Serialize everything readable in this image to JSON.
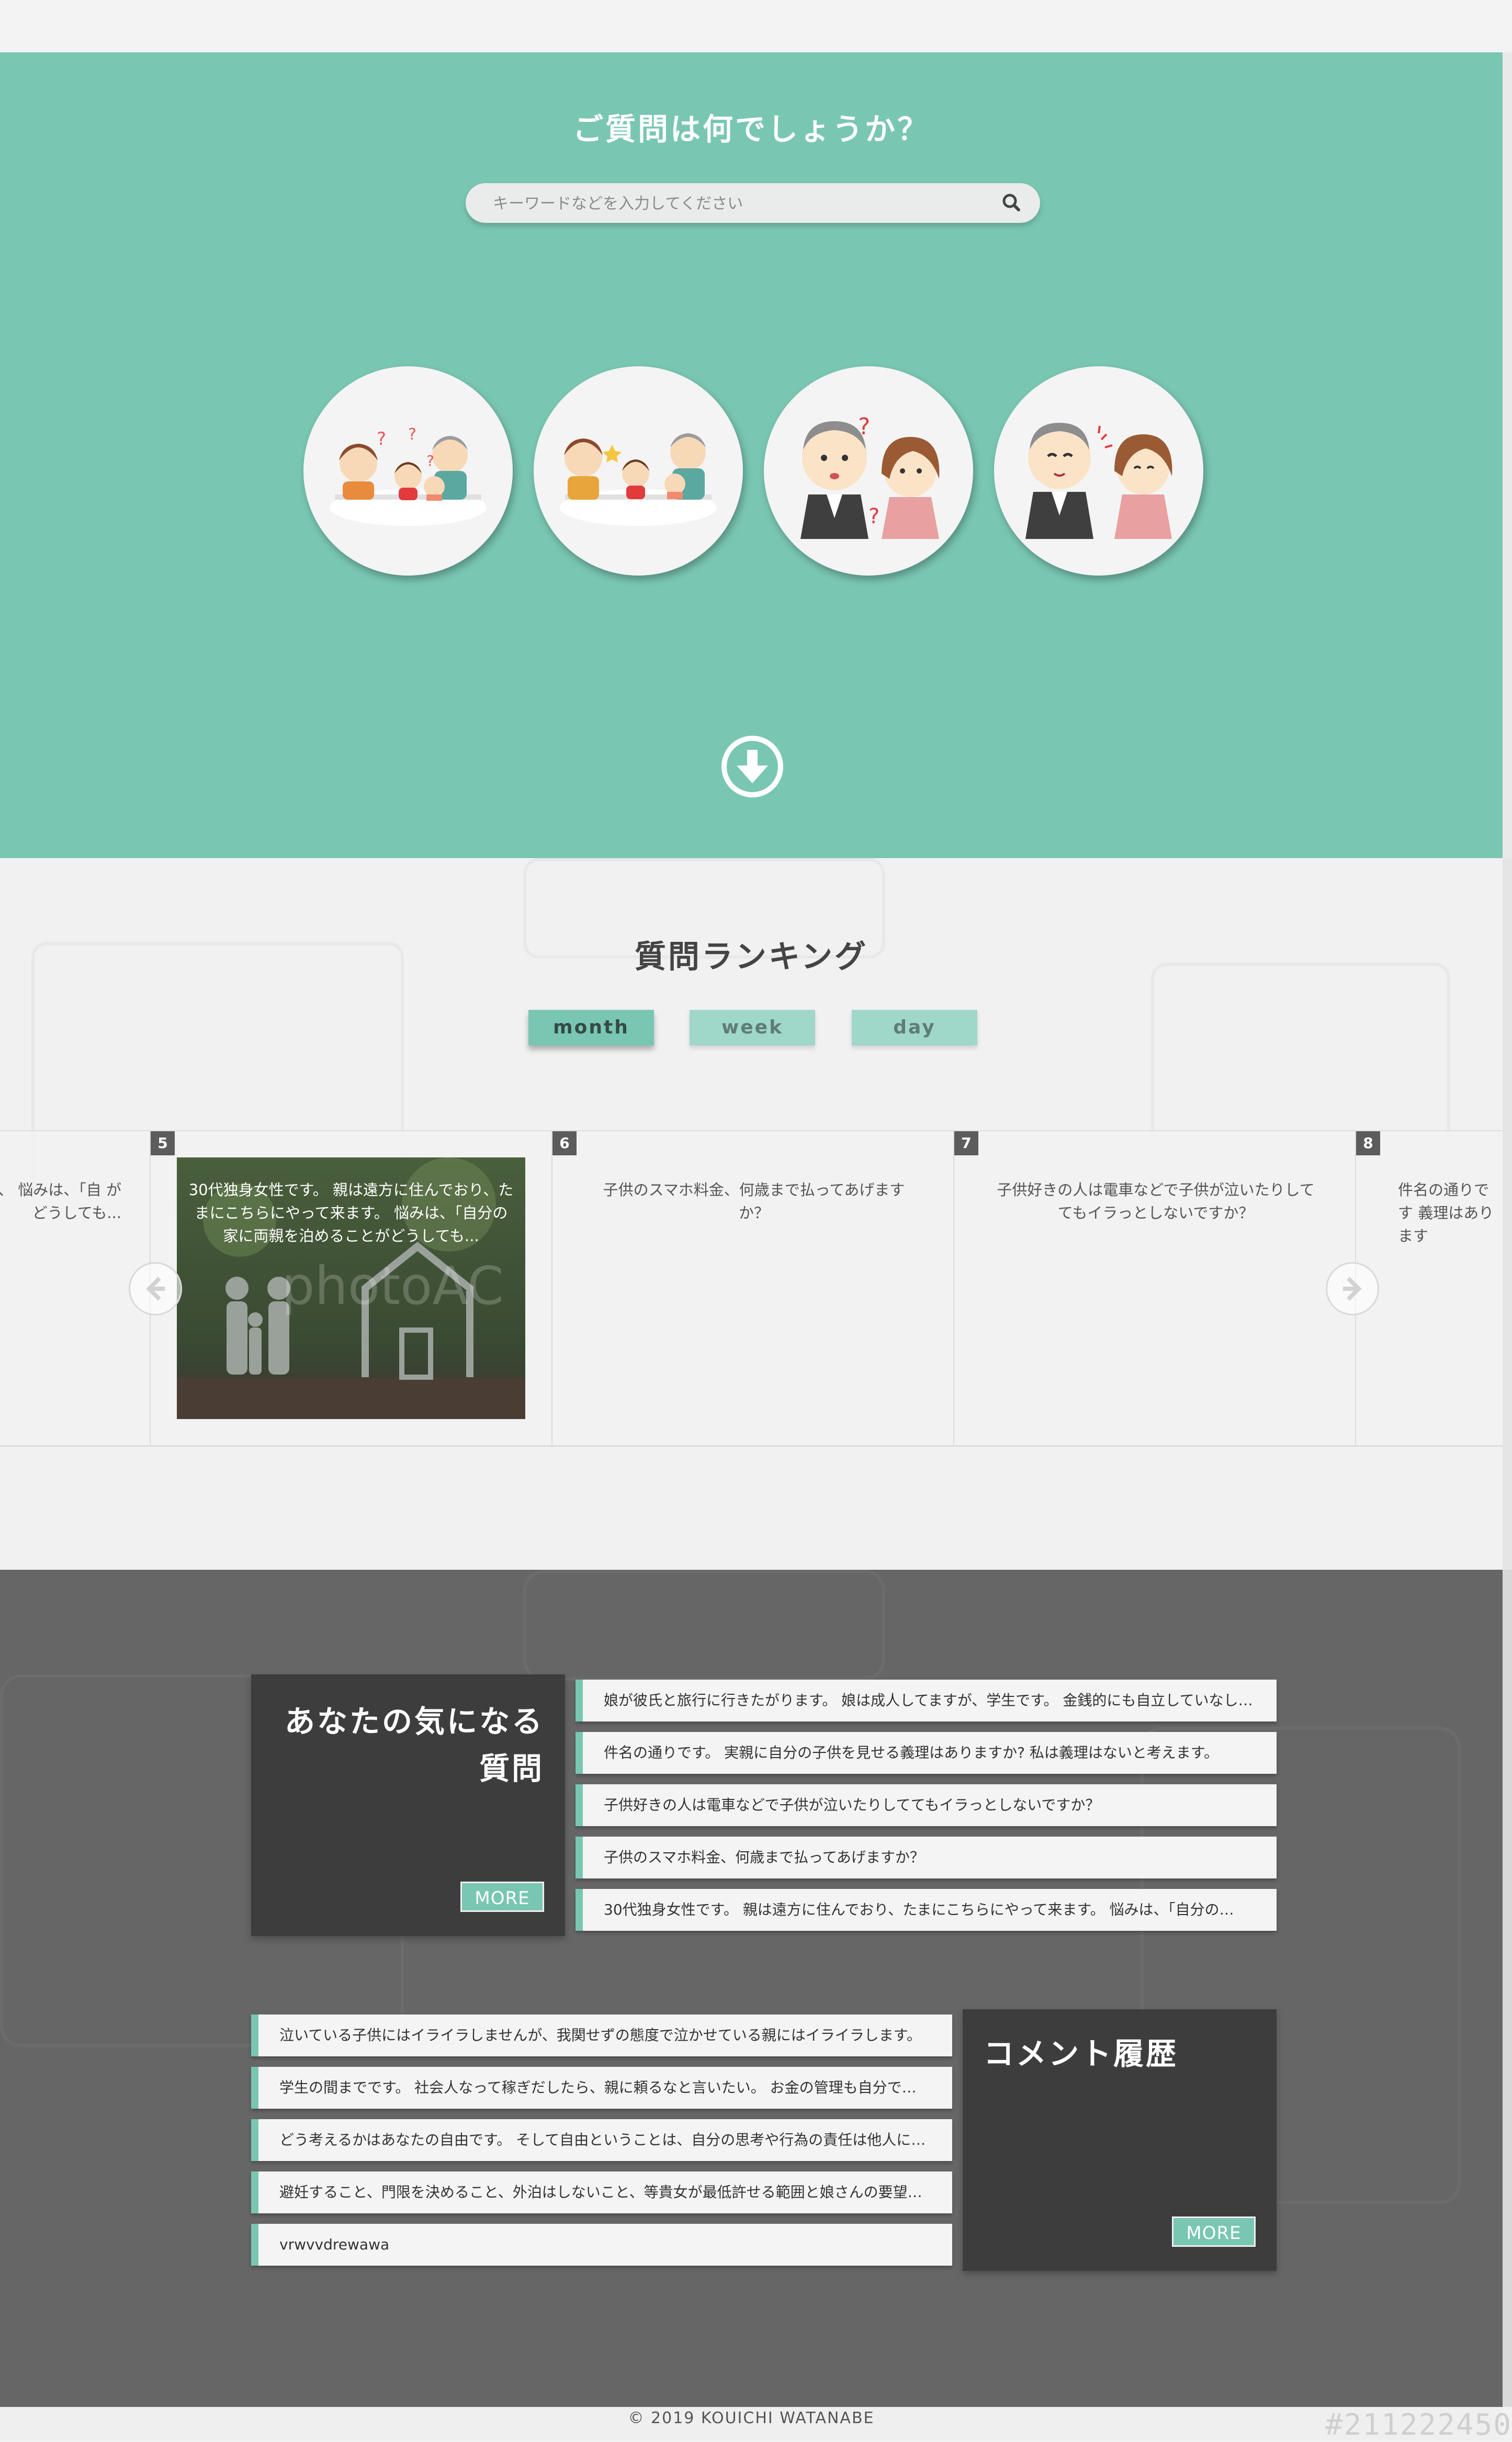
{
  "hero": {
    "title": "ご質問は何でしょうか？",
    "search_placeholder": "キーワードなどを入力してください",
    "category_icons": [
      "family-worried-icon",
      "family-happy-icon",
      "couple-confused-icon",
      "couple-agree-icon"
    ]
  },
  "ranking": {
    "title": "質問ランキング",
    "tabs": [
      "month",
      "week",
      "day"
    ],
    "active_tab": "month",
    "slides": [
      {
        "rank": "",
        "text": "に住んでおり、 悩みは、「自 がどうしても..."
      },
      {
        "rank": "5",
        "text": "30代独身女性です。 親は遠方に住んでおり、たまにこちらにやって来ます。 悩みは、「自分の家に両親を泊めることがどうしても..."
      },
      {
        "rank": "6",
        "text": "子供のスマホ料金、何歳まで払ってあげますか？"
      },
      {
        "rank": "7",
        "text": "子供好きの人は電車などで子供が泣いたりしててもイラっとしないですか？"
      },
      {
        "rank": "8",
        "text": "件名の通りです 義理はあります"
      }
    ],
    "photo_watermark": "photoAC"
  },
  "interest": {
    "title_line1": "あなたの気になる",
    "title_line2": "質問",
    "more_label": "MORE",
    "items": [
      "娘が彼氏と旅行に行きたがります。 娘は成人してますが、学生です。 金銭的にも自立していなし…",
      "件名の通りです。 実親に自分の子供を見せる義理はありますか? 私は義理はないと考えます。",
      "子供好きの人は電車などで子供が泣いたりしててもイラっとしないですか？",
      "子供のスマホ料金、何歳まで払ってあげますか？",
      "30代独身女性です。 親は遠方に住んでおり、たまにこちらにやって来ます。 悩みは、「自分の…"
    ]
  },
  "comments": {
    "title": "コメント履歴",
    "more_label": "MORE",
    "items": [
      "泣いている子供にはイライラしませんが、我関せずの態度で泣かせている親にはイライラします。",
      "学生の間までです。 社会人なって稼ぎだしたら、親に頼るなと言いたい。 お金の管理も自分で…",
      "どう考えるかはあなたの自由です。 そして自由ということは、自分の思考や行為の責任は他人に…",
      "避妊すること、門限を決めること、外泊はしないこと、等貴女が最低許せる範囲と娘さんの要望…",
      "vrwvvdrewawa"
    ]
  },
  "footer": {
    "copyright": "© 2019 KOUICHI WATANABE",
    "watermark": "#211222450"
  },
  "colors": {
    "accent": "#79c6b3",
    "dark_bg": "#666666",
    "box_bg": "#3d3d3d"
  }
}
